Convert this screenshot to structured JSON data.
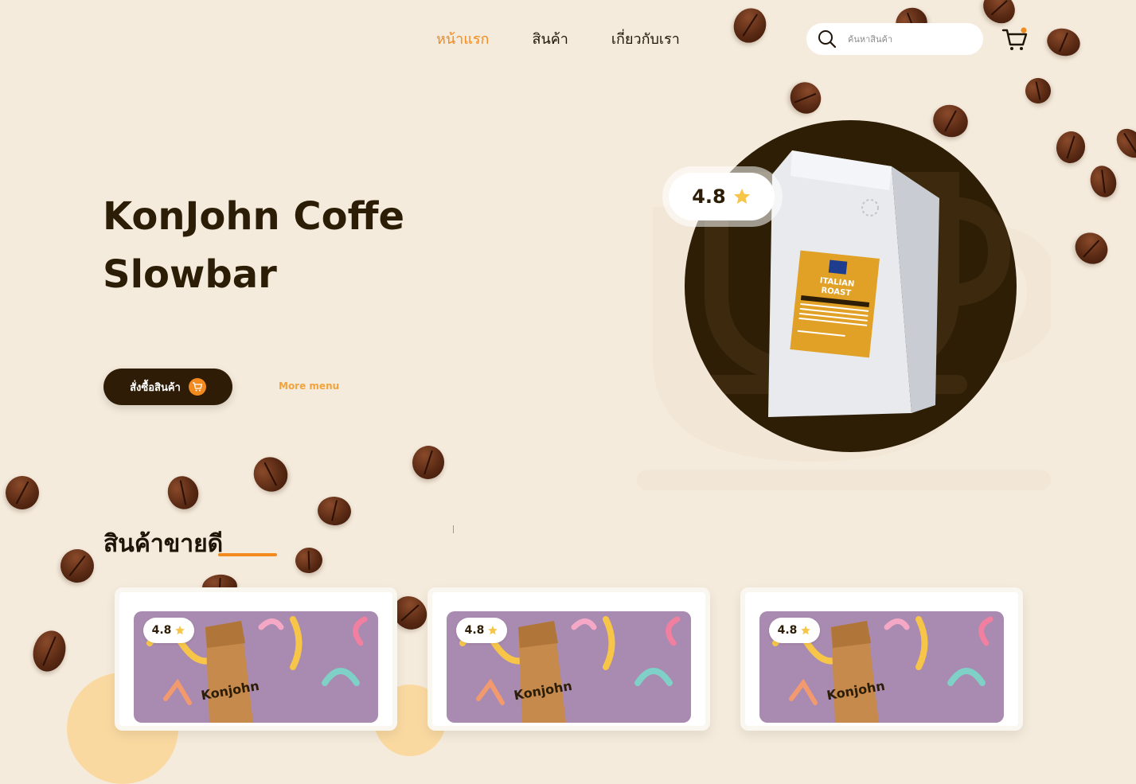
{
  "nav": {
    "items": [
      {
        "label": "หน้าแรก",
        "active": true
      },
      {
        "label": "สินค้า",
        "active": false
      },
      {
        "label": "เกี่ยวกับเรา",
        "active": false
      }
    ]
  },
  "search": {
    "placeholder": "ค้นหาสินค้า",
    "icon": "search-icon"
  },
  "cart": {
    "icon": "cart-icon",
    "has_notification": true
  },
  "hero": {
    "title_line1": "KonJohn Coffe",
    "title_line2": "Slowbar",
    "order_button": "สั่งซื้อสินค้า",
    "more_link": "More menu",
    "rating": "4.8",
    "product_label": "ITALIAN ROAST"
  },
  "bestsellers": {
    "title": "สินค้าขายดี",
    "products": [
      {
        "rating": "4.8",
        "bag_label": "Konjohn"
      },
      {
        "rating": "4.8",
        "bag_label": "Konjohn"
      },
      {
        "rating": "4.8",
        "bag_label": "Konjohn"
      }
    ]
  },
  "colors": {
    "accent": "#f28a1e",
    "dark": "#2e1c06",
    "background": "#f5ebdc",
    "star": "#f7c548"
  }
}
